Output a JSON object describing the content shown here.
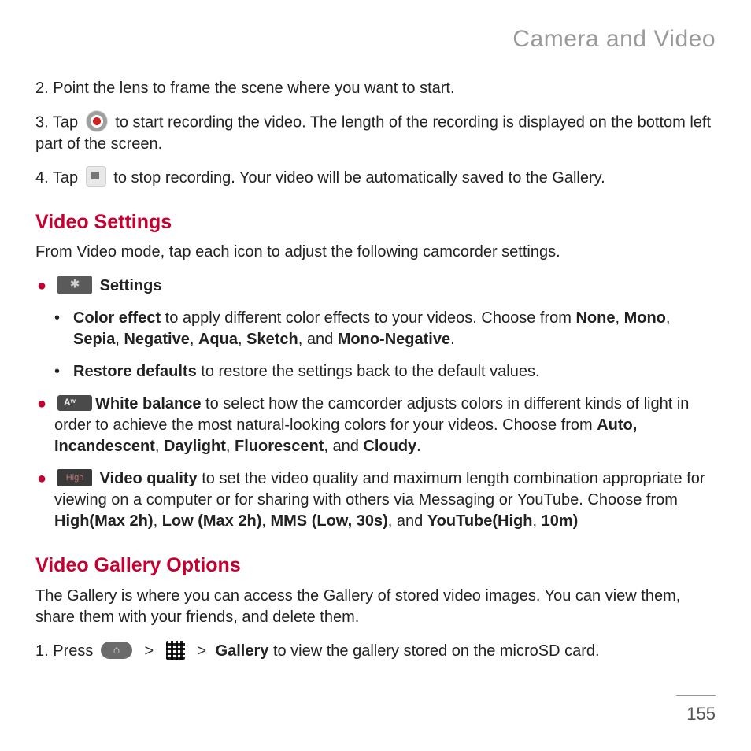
{
  "chapter": "Camera and Video",
  "steps": {
    "s2_num": "2.",
    "s2_text": "Point the lens to frame the scene where you want to start.",
    "s3_num": "3.",
    "s3_a": "Tap ",
    "s3_b": " to start recording the video. The length of the recording is displayed on the bottom left part of the screen.",
    "s4_num": "4.",
    "s4_a": "Tap ",
    "s4_b": " to stop recording. Your video will be automatically saved to the Gallery."
  },
  "video_settings": {
    "heading": "Video Settings",
    "intro": "From Video mode, tap each icon to adjust the following camcorder settings.",
    "settings_label": "Settings",
    "color": {
      "lead_bold": "Color effect",
      "text_a": " to apply different color effects to your videos. Choose from ",
      "opt1": "None",
      "c1": ", ",
      "opt2": "Mono",
      "c2": ", ",
      "opt3": "Sepia",
      "c3": ", ",
      "opt4": "Negative",
      "c4": ", ",
      "opt5": "Aqua",
      "c5": ", ",
      "opt6": "Sketch",
      "c6": ", and ",
      "opt7": "Mono-Negative",
      "c7": "."
    },
    "restore": {
      "lead_bold": "Restore defaults",
      "text": " to restore the settings back to the default values."
    },
    "wb": {
      "lead_bold": "White balance",
      "text_a": " to select how the camcorder adjusts colors in different kinds of light in order to achieve the most natural-looking colors for your videos. Choose from ",
      "opt1": "Auto, Incandescent",
      "c1": ", ",
      "opt2": "Daylight",
      "c2": ", ",
      "opt3": "Fluorescent",
      "c3": ", and ",
      "opt4": "Cloudy",
      "c4": "."
    },
    "quality": {
      "icon_text": "High",
      "lead_bold": "Video quality",
      "text_a": " to set the video quality and maximum length combination appropriate for viewing on a computer or for sharing with others via Messaging or YouTube. Choose from ",
      "opt1": "High(Max 2h)",
      "c1": ", ",
      "opt2": "Low (Max 2h)",
      "c2": ", ",
      "opt3": "MMS (Low, 30s)",
      "c3": ", and ",
      "opt4": "YouTube(High",
      "c4": ", ",
      "opt5": "10m)"
    }
  },
  "gallery": {
    "heading": "Video Gallery Options",
    "intro": "The Gallery is where you can access the Gallery of stored video images. You can view them, share them with your friends, and delete them.",
    "s1_num": "1.",
    "s1_a": "Press ",
    "gt": ">",
    "gallery_bold": "Gallery",
    "s1_b": " to view the gallery stored on the microSD card."
  },
  "page_number": "155"
}
